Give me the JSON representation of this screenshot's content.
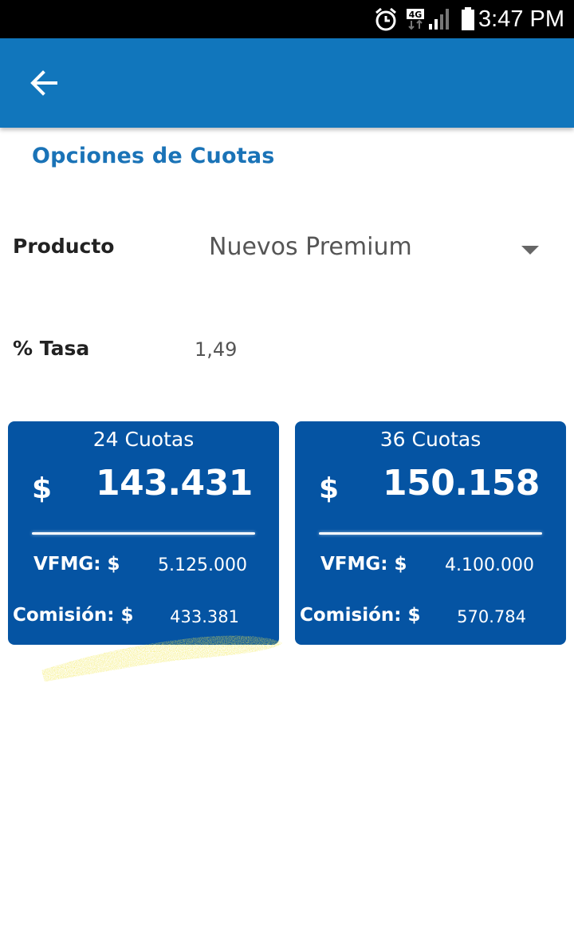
{
  "status_bar": {
    "time": "3:47 PM",
    "network": "4G",
    "icons": [
      "alarm-icon",
      "network-4g-icon",
      "signal-icon",
      "battery-icon"
    ]
  },
  "app_bar": {
    "back_icon": "arrow-left-icon",
    "color": "#1176bc"
  },
  "page": {
    "title": "Opciones de Cuotas"
  },
  "form": {
    "product_label": "Producto",
    "product_value": "Nuevos Premium",
    "rate_label": "% Tasa",
    "rate_value": "1,49"
  },
  "cards": [
    {
      "cuotas": "24 Cuotas",
      "currency": "$",
      "amount": "143.431",
      "vfmg_label": "VFMG: $",
      "vfmg_value": "5.125.000",
      "comision_label": "Comisión: $",
      "comision_value": "433.381"
    },
    {
      "cuotas": "36 Cuotas",
      "currency": "$",
      "amount": "150.158",
      "vfmg_label": "VFMG: $",
      "vfmg_value": "4.100.000",
      "comision_label": "Comisión: $",
      "comision_value": "570.784"
    }
  ],
  "colors": {
    "accent": "#1a73b7",
    "card": "#0554a3",
    "highlight": "#f2e84a"
  }
}
